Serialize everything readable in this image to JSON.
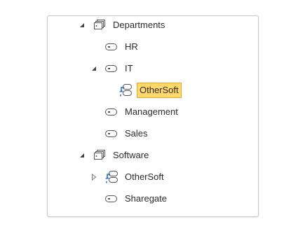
{
  "tree": {
    "nodes": [
      {
        "id": "departments",
        "label": "Departments",
        "icon": "group-tags-icon",
        "expander": "expanded"
      },
      {
        "id": "hr",
        "label": "HR",
        "icon": "tag-icon",
        "expander": "none"
      },
      {
        "id": "it",
        "label": "IT",
        "icon": "tag-icon",
        "expander": "expanded"
      },
      {
        "id": "it-othersoft",
        "label": "OtherSoft",
        "icon": "sync-tags-icon",
        "expander": "none",
        "selected": true
      },
      {
        "id": "management",
        "label": "Management",
        "icon": "tag-icon",
        "expander": "none"
      },
      {
        "id": "sales",
        "label": "Sales",
        "icon": "tag-icon",
        "expander": "none"
      },
      {
        "id": "software",
        "label": "Software",
        "icon": "group-tags-icon",
        "expander": "expanded"
      },
      {
        "id": "software-othersoft",
        "label": "OtherSoft",
        "icon": "sync-tags-icon",
        "expander": "collapsed"
      },
      {
        "id": "sharegate",
        "label": "Sharegate",
        "icon": "tag-icon",
        "expander": "none"
      }
    ]
  },
  "colors": {
    "selection_fill": "#ffd76a",
    "selection_border": "#e5a72a",
    "sync_arrow_blue": "#2f72c4",
    "icon_stroke": "#555555"
  }
}
